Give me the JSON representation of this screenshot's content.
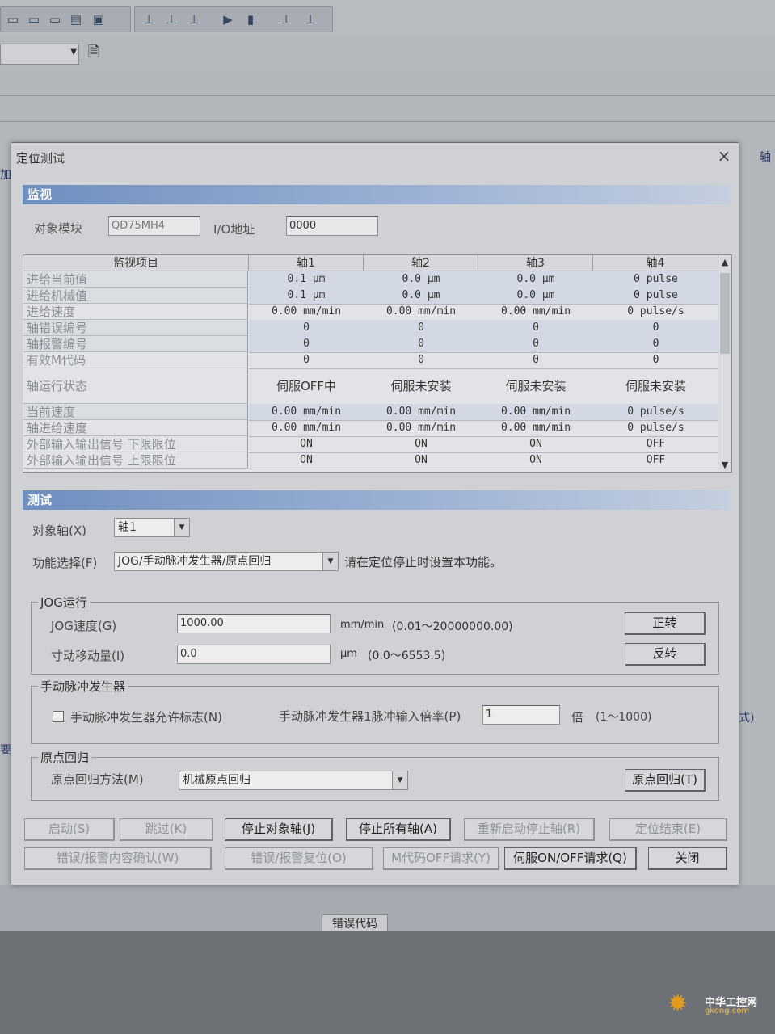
{
  "dialog": {
    "title": "定位测试",
    "close": "×",
    "monitor_section": "监视",
    "test_section": "测试",
    "target_module_label": "对象模块",
    "target_module_value": "QD75MH4",
    "io_address_label": "I/O地址",
    "io_address_value": "0000"
  },
  "monitor": {
    "header_item": "监视项目",
    "axes": [
      "轴1",
      "轴2",
      "轴3",
      "轴4"
    ],
    "rows": [
      {
        "label": "进给当前值",
        "values": [
          "0.1  μm",
          "0.0  μm",
          "0.0  μm",
          "0 pulse"
        ]
      },
      {
        "label": "进给机械值",
        "values": [
          "0.1  μm",
          "0.0  μm",
          "0.0  μm",
          "0 pulse"
        ]
      },
      {
        "label": "进给速度",
        "values": [
          "0.00 mm/min",
          "0.00 mm/min",
          "0.00 mm/min",
          "0 pulse/s"
        ]
      },
      {
        "label": "轴错误编号",
        "values": [
          "0",
          "0",
          "0",
          "0"
        ]
      },
      {
        "label": "轴报警编号",
        "values": [
          "0",
          "0",
          "0",
          "0"
        ]
      },
      {
        "label": "有效M代码",
        "values": [
          "0",
          "0",
          "0",
          "0"
        ]
      },
      {
        "label": "轴运行状态",
        "values": [
          "伺服OFF中",
          "伺服未安装",
          "伺服未安装",
          "伺服未安装"
        ]
      },
      {
        "label": "当前速度",
        "values": [
          "0.00 mm/min",
          "0.00 mm/min",
          "0.00 mm/min",
          "0 pulse/s"
        ]
      },
      {
        "label": "轴进给速度",
        "values": [
          "0.00 mm/min",
          "0.00 mm/min",
          "0.00 mm/min",
          "0 pulse/s"
        ]
      },
      {
        "label": "外部输入输出信号 下限限位",
        "values": [
          "ON",
          "ON",
          "ON",
          "OFF"
        ]
      },
      {
        "label": "外部输入输出信号 上限限位",
        "values": [
          "ON",
          "ON",
          "ON",
          "OFF"
        ]
      }
    ]
  },
  "test": {
    "target_axis_label": "对象轴(X)",
    "target_axis_value": "轴1",
    "function_label": "功能选择(F)",
    "function_value": "JOG/手动脉冲发生器/原点回归",
    "function_note": "请在定位停止时设置本功能。"
  },
  "jog": {
    "group_title": "JOG运行",
    "speed_label": "JOG速度(G)",
    "speed_value": "1000.00",
    "speed_unit": "mm/min",
    "speed_range": "(0.01～20000000.00)",
    "inching_label": "寸动移动量(I)",
    "inching_value": "0.0",
    "inching_unit": "μm",
    "inching_range": "(0.0～6553.5)",
    "forward_button": "正转",
    "reverse_button": "反转"
  },
  "mpg": {
    "group_title": "手动脉冲发生器",
    "enable_label": "手动脉冲发生器允许标志(N)",
    "ratio_label": "手动脉冲发生器1脉冲输入倍率(P)",
    "ratio_value": "1",
    "ratio_unit": "倍",
    "ratio_range": "(1～1000)"
  },
  "home": {
    "group_title": "原点回归",
    "method_label": "原点回归方法(M)",
    "method_value": "机械原点回归",
    "home_button": "原点回归(T)"
  },
  "buttons": {
    "start": "启动(S)",
    "skip": "跳过(K)",
    "stop_axis": "停止对象轴(J)",
    "stop_all": "停止所有轴(A)",
    "restart": "重新启动停止轴(R)",
    "position_end": "定位结束(E)",
    "error_confirm": "错误/报警内容确认(W)",
    "error_reset": "错误/报警复位(O)",
    "m_code_off": "M代码OFF请求(Y)",
    "servo_onoff": "伺服ON/OFF请求(Q)",
    "close": "关闭"
  },
  "background": {
    "error_code_label": "错误代码",
    "right_fragment_top": "轴",
    "right_fragment_mid": "式)",
    "left_fragment": "加",
    "left_fragment2": "要",
    "watermark_line1": "中华工控网",
    "watermark_line2": "gkong.com"
  }
}
